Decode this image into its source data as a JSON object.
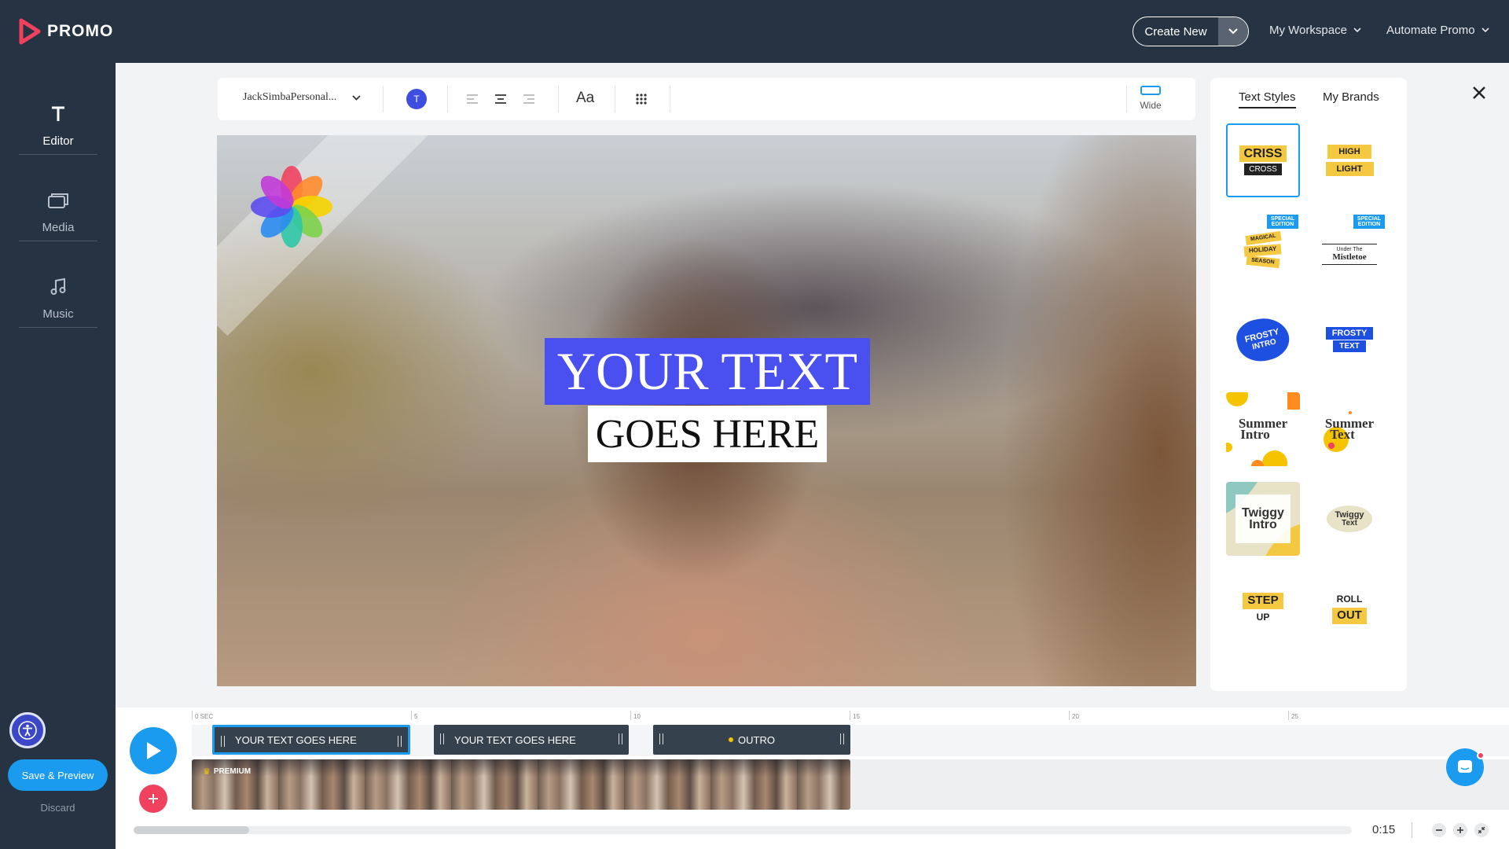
{
  "app": {
    "brand": "PROMO"
  },
  "header": {
    "create_new": "Create New",
    "workspace": "My Workspace",
    "automate": "Automate Promo"
  },
  "sidebar": {
    "items": [
      {
        "label": "Editor",
        "icon": "text-t-icon",
        "active": true
      },
      {
        "label": "Media",
        "icon": "media-icon",
        "active": false
      },
      {
        "label": "Music",
        "icon": "music-note-icon",
        "active": false
      }
    ],
    "save_preview": "Save & Preview",
    "discard": "Discard"
  },
  "toolbar": {
    "font_name": "JackSimbaPersonal...",
    "color_letter": "T",
    "text_size": "Aa",
    "aspect": "Wide"
  },
  "canvas": {
    "line1": "YOUR TEXT",
    "line2": "GOES HERE"
  },
  "styles_panel": {
    "tabs": [
      "Text Styles",
      "My Brands"
    ],
    "cards": [
      {
        "a": "CRISS",
        "b": "CROSS"
      },
      {
        "a": "HIGH",
        "b": "LIGHT"
      },
      {
        "a": "MAGICAL",
        "b": "HOLIDAY",
        "c": "SEASON",
        "badge": "SPECIAL EDITION"
      },
      {
        "a": "Under The",
        "b": "Mistletoe",
        "badge": "SPECIAL EDITION"
      },
      {
        "a": "FROSTY",
        "b": "INTRO"
      },
      {
        "a": "FROSTY",
        "b": "TEXT"
      },
      {
        "a": "Summer",
        "b": "Intro"
      },
      {
        "a": "Summer",
        "b": "Text"
      },
      {
        "a": "Twiggy",
        "b": "Intro"
      },
      {
        "a": "Twiggy",
        "b": "Text"
      },
      {
        "a": "STEP",
        "b": "UP"
      },
      {
        "a": "ROLL",
        "b": "OUT"
      }
    ]
  },
  "timeline": {
    "ruler": [
      "0 SEC",
      "5",
      "10",
      "15",
      "20",
      "25"
    ],
    "clips": [
      "YOUR TEXT GOES HERE",
      "YOUR TEXT GOES HERE",
      "OUTRO"
    ],
    "premium": "PREMIUM",
    "timecode": "0:15",
    "scroll_fraction": 0.095
  },
  "colors": {
    "accent": "#1a9bf0",
    "dark": "#263342",
    "title_bg": "#4a4ff0",
    "add": "#f0415f"
  }
}
